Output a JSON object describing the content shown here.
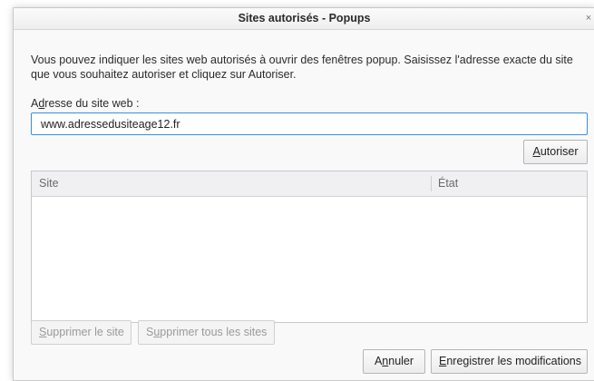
{
  "window": {
    "title": "Sites autorisés - Popups",
    "close_glyph": "×"
  },
  "description": "Vous pouvez indiquer les sites web autorisés à ouvrir des fenêtres popup. Saisissez l'adresse exacte du site que vous souhaitez autoriser et cliquez sur Autoriser.",
  "address": {
    "label_accesskey": "d",
    "label_pre": "A",
    "label_post": "resse du site web :",
    "value": "www.adressedusiteage12.fr"
  },
  "buttons": {
    "allow_accesskey": "A",
    "allow_rest": "utoriser",
    "remove_site_accesskey": "S",
    "remove_site_rest": "upprimer le site",
    "remove_all_pre": "S",
    "remove_all_accesskey": "u",
    "remove_all_rest": "pprimer tous les sites",
    "cancel_pre": "A",
    "cancel_accesskey": "n",
    "cancel_rest": "nuler",
    "save_accesskey": "E",
    "save_rest": "nregistrer les modifications"
  },
  "table": {
    "columns": [
      "Site",
      "État"
    ],
    "rows": []
  }
}
